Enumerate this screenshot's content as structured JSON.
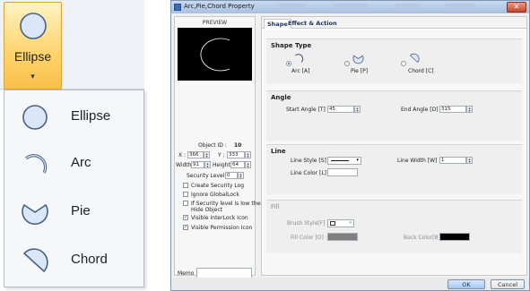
{
  "ribbon": {
    "button_label": "Ellipse",
    "button_icon": "ellipse-icon",
    "caret": "▾"
  },
  "shape_menu": {
    "items": [
      {
        "label": "Ellipse",
        "icon": "ellipse-icon"
      },
      {
        "label": "Arc",
        "icon": "arc-icon"
      },
      {
        "label": "Pie",
        "icon": "pie-icon"
      },
      {
        "label": "Chord",
        "icon": "chord-icon"
      }
    ]
  },
  "dialog": {
    "title": "Arc,Pie,Chord Property",
    "close_glyph": "✕",
    "preview_label": "PREVIEW",
    "object_id_label": "Object ID :",
    "object_id_value": "10",
    "x_label": "X :",
    "x_value": "366",
    "y_label": "Y :",
    "y_value": "333",
    "width_label": "Width :",
    "width_value": "91",
    "height_label": "Height :",
    "height_value": "64",
    "security_level_label": "Security Level :",
    "security_level_value": "0",
    "checkboxes": [
      {
        "label": "Create Security Log",
        "checked": false
      },
      {
        "label": "Ignore GlobalLock",
        "checked": false
      },
      {
        "label": "If Security level is low then",
        "label2": "Hide Object",
        "checked": false
      },
      {
        "label": "Visible InterLock Icon",
        "checked": true
      },
      {
        "label": "Visible Permission Icon",
        "checked": true
      }
    ],
    "memo_label": "Memo :",
    "tabs": [
      "Shape",
      "Effect & Action"
    ],
    "shape_type": {
      "title": "Shape Type",
      "options": [
        {
          "label": "Arc [A]",
          "selected": true
        },
        {
          "label": "Pie [P]",
          "selected": false
        },
        {
          "label": "Chord [C]",
          "selected": false
        }
      ]
    },
    "angle": {
      "title": "Angle",
      "start_label": "Start Angle [T] :",
      "start_value": "45",
      "end_label": "End Angle [D] :",
      "end_value": "315"
    },
    "line": {
      "title": "Line",
      "style_label": "Line Style [S] :",
      "width_label": "Line Width [W] :",
      "width_value": "1",
      "color_label": "Line Color [L] :",
      "color_value": "#ffffff"
    },
    "fill": {
      "title": "Fill",
      "brush_label": "Brush Style[F] :",
      "fill_color_label": "Fill Color [O] :",
      "fill_color_value": "#808080",
      "back_color_label": "Back Color[B] :",
      "back_color_value": "#000000"
    },
    "ok_label": "OK",
    "cancel_label": "Cancel"
  }
}
